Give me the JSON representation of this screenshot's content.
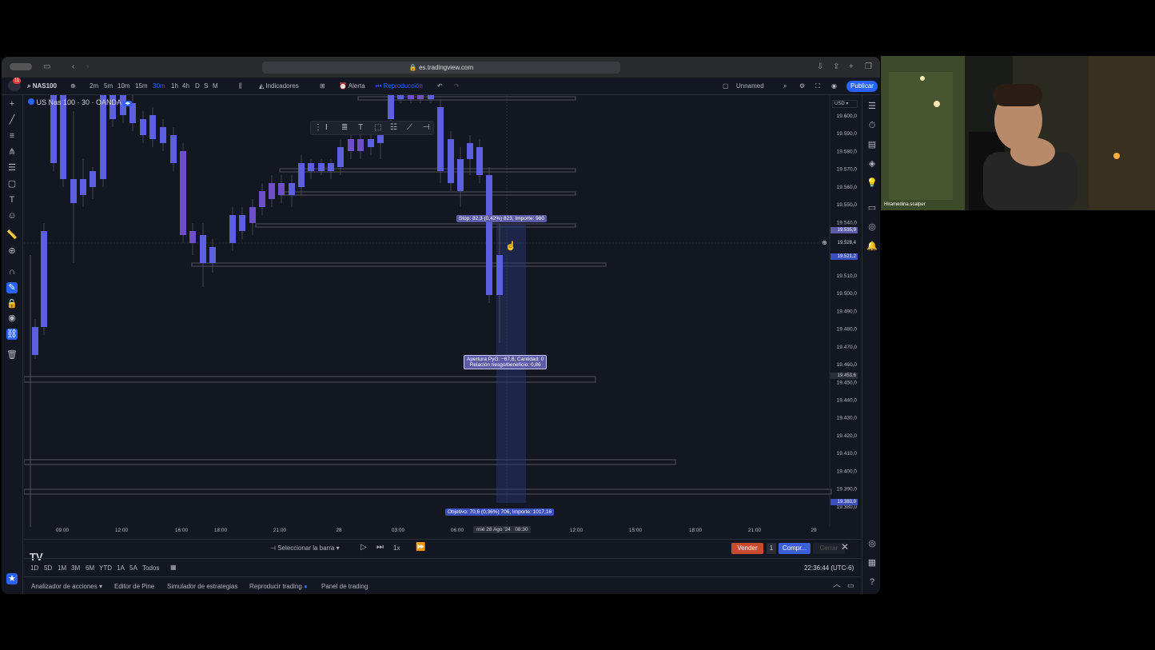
{
  "browser": {
    "url": "es.tradingview.com"
  },
  "toolbar": {
    "symbol": "NAS100",
    "notif_count": "11",
    "timeframes": [
      "2m",
      "5m",
      "10m",
      "15m",
      "30m",
      "1h",
      "4h",
      "D",
      "S",
      "M"
    ],
    "active_timeframe": "30m",
    "indicators_label": "Indicadores",
    "alert_label": "Alerta",
    "replay_label": "Reproducción",
    "layout_name": "Unnamed",
    "publish_label": "Publicar"
  },
  "chart": {
    "legend": "US Nas 100 · 30 · OANDA",
    "currency": "USD",
    "price_ticks": [
      "19.600,0",
      "19.590,0",
      "19.580,0",
      "19.570,0",
      "19.560,0",
      "19.550,0",
      "19.540,0",
      "19.510,0",
      "19.500,0",
      "19.490,0",
      "19.480,0",
      "19.470,0",
      "19.460,0",
      "19.450,0",
      "19.440,0",
      "19.430,0",
      "19.420,0",
      "19.410,0",
      "19.400,0",
      "19.390,0",
      "19.380,0"
    ],
    "price_badges": {
      "stop": "19.535,9",
      "current": "19.528,4",
      "entry": "19.521,2",
      "mid": "19.453,6",
      "target": "19.383,0"
    },
    "time_ticks": [
      "09:00",
      "12:00",
      "16:00",
      "18:00",
      "21:00",
      "28",
      "03:00",
      "06:00",
      "12:00",
      "15:00",
      "18:00",
      "21:00",
      "29"
    ],
    "crosshair_time": "mié 28 Ago '24   08:30",
    "stop_label": "Stop: 82,3 (0,42%) 823, Importe: 980",
    "open_pnl_line1": "Apertura PyG: −67,6, Cantidad: 0",
    "open_pnl_line2": "Relación riesgo/beneficio: 0,86",
    "target_label": "Objetivo: 70,6 (0,36%) 706, Importe: 1017,16",
    "tv_logo": "TV"
  },
  "replay_bar": {
    "select_bar": "Seleccionar la barra",
    "speed": "1x",
    "sell": "Vender",
    "qty": "1",
    "buy": "Compr...",
    "close": "Cerrar"
  },
  "ranges": {
    "items": [
      "1D",
      "5D",
      "1M",
      "3M",
      "6M",
      "YTD",
      "1A",
      "5A",
      "Todos"
    ],
    "clock": "22:36:44 (UTC-6)"
  },
  "bottom_tabs": [
    "Analizador de acciones",
    "Editor de Pine",
    "Simulador de estrategias",
    "Reproducir trading",
    "Panel de trading"
  ],
  "webcam": {
    "name": "Hiramedina.scalper"
  },
  "colors": {
    "bg": "#131722",
    "candle": "#5b5fe0",
    "candle_dim": "#6f4fc8",
    "accent": "#2962ff"
  }
}
